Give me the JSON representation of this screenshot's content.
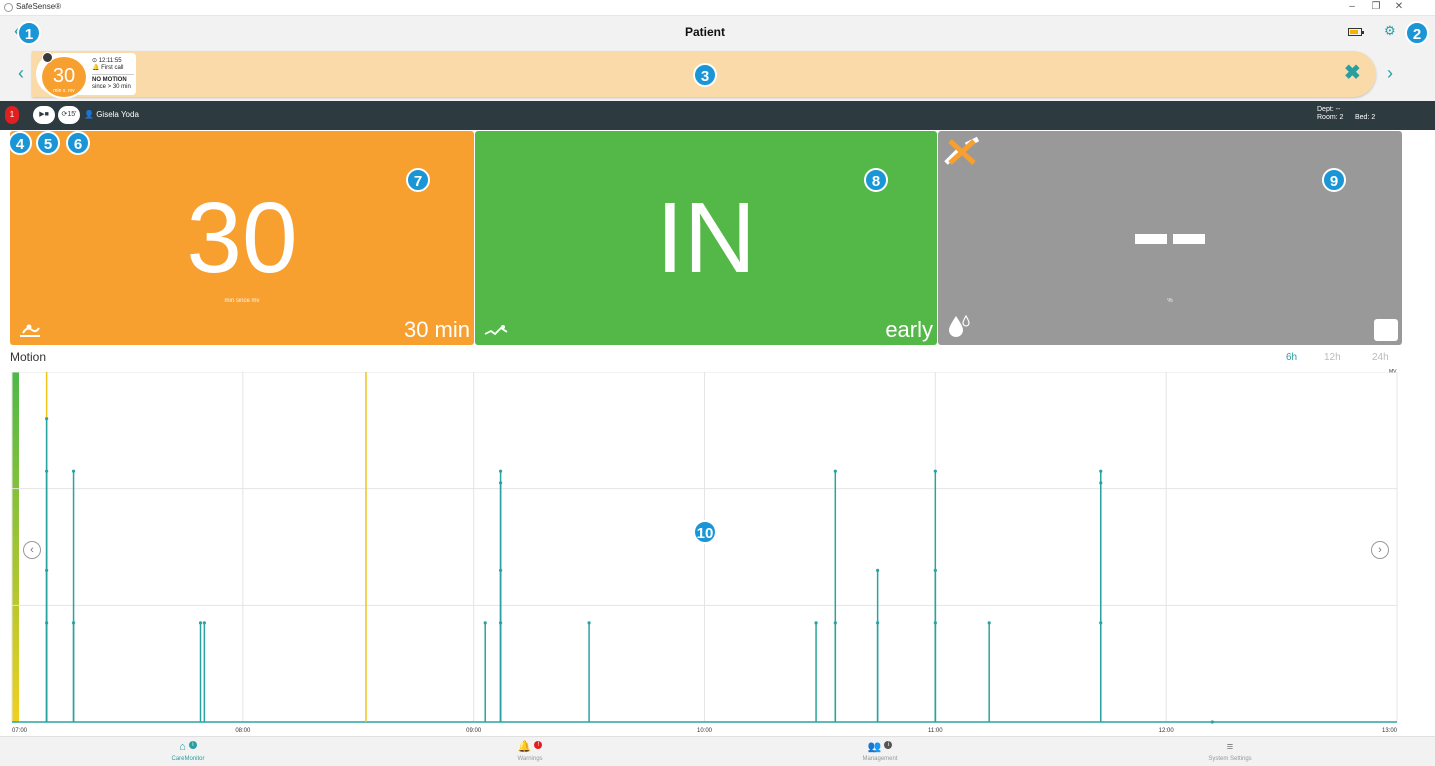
{
  "window": {
    "app_title": "SafeSense®",
    "minimize": "–",
    "restore": "❐",
    "close": "✕"
  },
  "header": {
    "back_icon": "‹",
    "title": "Patient",
    "settings_icon": "⚙"
  },
  "badges": [
    "1",
    "2",
    "3",
    "4",
    "5",
    "6",
    "7",
    "8",
    "9",
    "10"
  ],
  "alert": {
    "nav_prev": "‹",
    "nav_next": "›",
    "value": "30",
    "value_unit": "min s. mv",
    "time": "⊙ 12:11:55",
    "call": "🔔 First call",
    "status": "NO MOTION",
    "since": "since > 30 min",
    "dismiss_icon": "✖"
  },
  "patient": {
    "alarm_count": "1",
    "play_stop": "▶■",
    "interval": "⟳15'",
    "name": "Gisela Yoda",
    "dept": "Dept: --",
    "room": "Room: 2",
    "bed": "Bed: 2"
  },
  "tiles": {
    "motion": {
      "value": "30",
      "sub": "min since mv",
      "corner": "30 min"
    },
    "bed": {
      "value": "IN",
      "corner": "early"
    },
    "wet": {
      "value": "--",
      "sub": "%"
    }
  },
  "chart_data": {
    "type": "bar",
    "title": "Motion",
    "ranges": [
      "6h",
      "12h",
      "24h"
    ],
    "active_range": "6h",
    "ylabel": "MV",
    "x_ticks": [
      "07:00",
      "08:00",
      "09:00",
      "10:00",
      "11:00",
      "12:00",
      "13:00"
    ],
    "xlim": [
      "07:00",
      "13:00"
    ],
    "ylim": [
      0,
      3
    ],
    "yellow_markers": [
      "07:09",
      "08:32"
    ],
    "points": [
      {
        "t": "07:09",
        "v": 2.6
      },
      {
        "t": "07:09",
        "v": 2.15
      },
      {
        "t": "07:09",
        "v": 1.3
      },
      {
        "t": "07:09",
        "v": 0.85
      },
      {
        "t": "07:16",
        "v": 2.15
      },
      {
        "t": "07:16",
        "v": 0.85
      },
      {
        "t": "07:49",
        "v": 0.85
      },
      {
        "t": "07:50",
        "v": 0.85
      },
      {
        "t": "09:03",
        "v": 0.85
      },
      {
        "t": "09:07",
        "v": 2.15
      },
      {
        "t": "09:07",
        "v": 2.05
      },
      {
        "t": "09:07",
        "v": 1.3
      },
      {
        "t": "09:07",
        "v": 0.85
      },
      {
        "t": "09:30",
        "v": 0.85
      },
      {
        "t": "10:29",
        "v": 0.85
      },
      {
        "t": "10:34",
        "v": 2.15
      },
      {
        "t": "10:34",
        "v": 0.85
      },
      {
        "t": "10:45",
        "v": 1.3
      },
      {
        "t": "10:45",
        "v": 0.85
      },
      {
        "t": "11:00",
        "v": 2.15
      },
      {
        "t": "11:00",
        "v": 1.3
      },
      {
        "t": "11:00",
        "v": 0.85
      },
      {
        "t": "11:14",
        "v": 0.85
      },
      {
        "t": "11:43",
        "v": 2.15
      },
      {
        "t": "11:43",
        "v": 2.05
      },
      {
        "t": "11:43",
        "v": 0.85
      },
      {
        "t": "12:12",
        "v": 0.0
      }
    ],
    "grid": true,
    "colors": {
      "line": "#2aa3a0",
      "marker": "#f0c419"
    }
  },
  "chart_nav": {
    "prev": "‹",
    "next": "›"
  },
  "bottomnav": [
    {
      "icon": "⌂",
      "label": "CareMonitor",
      "dot": "i",
      "dot_color": "#2a9da0"
    },
    {
      "icon": "🔔",
      "label": "Warnings",
      "dot": "!",
      "dot_color": "#e02020"
    },
    {
      "icon": "👥",
      "label": "Management",
      "dot": "i",
      "dot_color": "#555555"
    },
    {
      "icon": "≡",
      "label": "System Settings"
    }
  ]
}
